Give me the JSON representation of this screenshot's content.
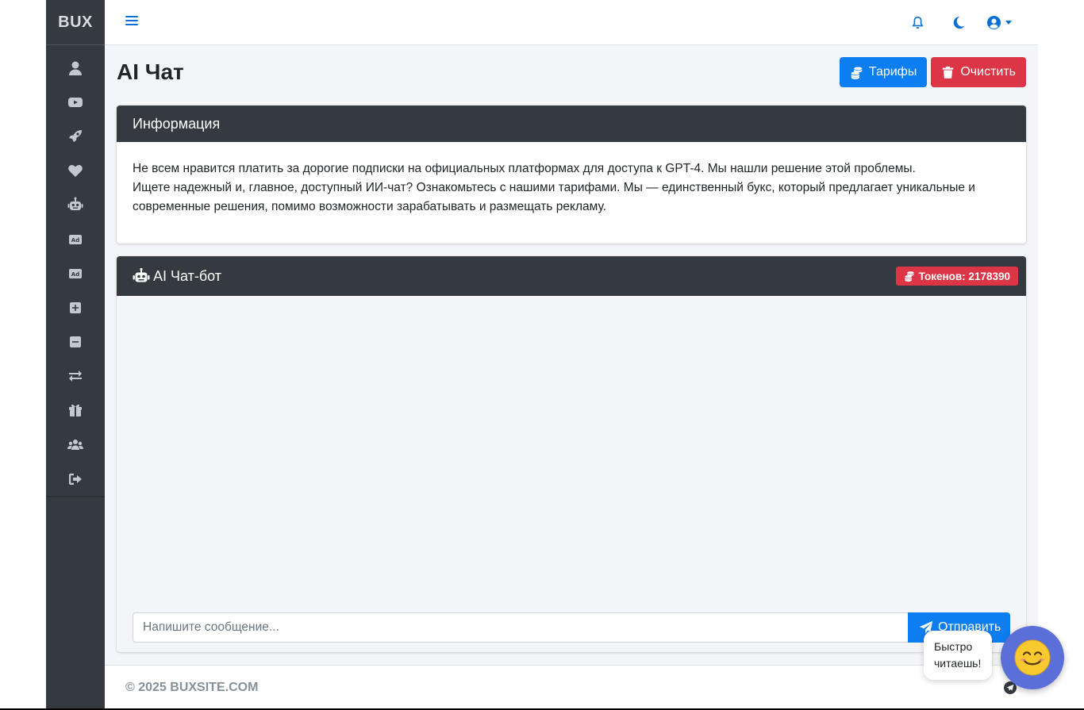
{
  "brand": "BUX",
  "sidebar": {
    "items": [
      {
        "icon": "user-icon"
      },
      {
        "icon": "youtube-icon"
      },
      {
        "icon": "rocket-icon"
      },
      {
        "icon": "heart-icon"
      },
      {
        "icon": "robot-icon"
      },
      {
        "icon": "ad-icon"
      },
      {
        "icon": "ad-icon"
      },
      {
        "icon": "plus-square-icon"
      },
      {
        "icon": "minus-square-icon"
      },
      {
        "icon": "exchange-icon"
      },
      {
        "icon": "gift-icon"
      },
      {
        "icon": "users-icon"
      },
      {
        "icon": "sign-out-icon"
      }
    ]
  },
  "header": {
    "title": "AI Чат",
    "tariffs_label": "Тарифы",
    "clear_label": "Очистить"
  },
  "info": {
    "title": "Информация",
    "line1": "Не всем нравится платить за дорогие подписки на официальных платформах для доступа к GPT-4. Мы нашли решение этой проблемы.",
    "line2": "Ищете надежный и, главное, доступный ИИ-чат? Ознакомьтесь с нашими тарифами. Мы — единственный букс, который предлагает уникальные и современные решения, помимо возможности зарабатывать и размещать рекламу."
  },
  "chat": {
    "title": "AI Чат-бот",
    "tokens_label": "Токенов: 2178390",
    "input_placeholder": "Напишите сообщение...",
    "send_label": "Отправить"
  },
  "footer": {
    "copyright": "© 2025 BUXSITE.COM"
  },
  "widget": {
    "bubble_text": "Быстро читаешь!"
  },
  "colors": {
    "primary": "#0d7ef2",
    "danger": "#dc3545",
    "dark": "#343a40",
    "widget": "#5b6fd9"
  }
}
